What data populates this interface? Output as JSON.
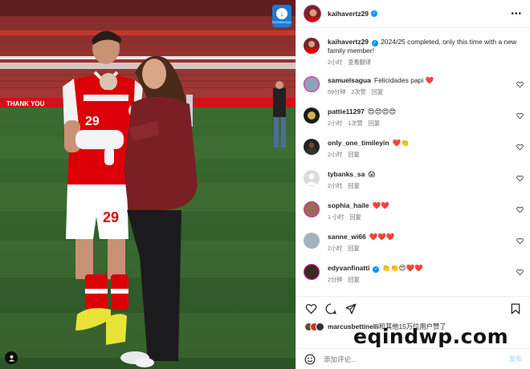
{
  "photo": {
    "download_badge_text": "DOWNLOAD",
    "stand_banner": "THANK YOU",
    "player_number": "29"
  },
  "post": {
    "username": "kaihavertz29",
    "verified": true,
    "more_icon": "more-horizontal-icon",
    "caption_username": "kaihavertz29",
    "caption": "2024/25 completed, only this time with a new family member!",
    "caption_time": "2小时",
    "caption_translate": "查看翻译"
  },
  "comments": [
    {
      "username": "samuelsagua",
      "text": "Felicidades papi ❤️",
      "time": "59分钟",
      "likes": "2次赞",
      "reply": "回复"
    },
    {
      "username": "pattie11297",
      "text": "😍😍😍😍",
      "time": "2小时",
      "likes": "1次赞",
      "reply": "回复"
    },
    {
      "username": "only_one_timileyin",
      "text": "❤️👏",
      "time": "2小时",
      "likes": "",
      "reply": "回复"
    },
    {
      "username": "tybanks_sa",
      "text": "😱",
      "time": "2小时",
      "likes": "",
      "reply": "回复"
    },
    {
      "username": "sophia_haile",
      "text": "❤️❤️",
      "time": "1 小时",
      "likes": "",
      "reply": "回复"
    },
    {
      "username": "sanne_wi66",
      "text": "❤️❤️❤️",
      "time": "2小时",
      "likes": "",
      "reply": "回复"
    },
    {
      "username": "edyvanfinatti",
      "text": "👏👏😍❤️❤️",
      "time": "2分钟",
      "likes": "",
      "reply": "回复",
      "verified": true
    }
  ],
  "actions": {
    "like_icon": "heart-icon",
    "comment_icon": "comment-icon",
    "share_icon": "send-icon",
    "save_icon": "bookmark-icon"
  },
  "likes_text": {
    "user": "marcusbettinelli",
    "rest": "和其他15万位用户赞了"
  },
  "add_comment": {
    "emoji_icon": "smiley-icon",
    "placeholder": "添加评论...",
    "post_label": "发布"
  },
  "watermark": "eqindwp.com",
  "colors": {
    "verified_blue": "#0095f6",
    "arsenal_red": "#db0007",
    "pitch_green": "#3f6e33",
    "download_blue": "#1f7ad6"
  }
}
